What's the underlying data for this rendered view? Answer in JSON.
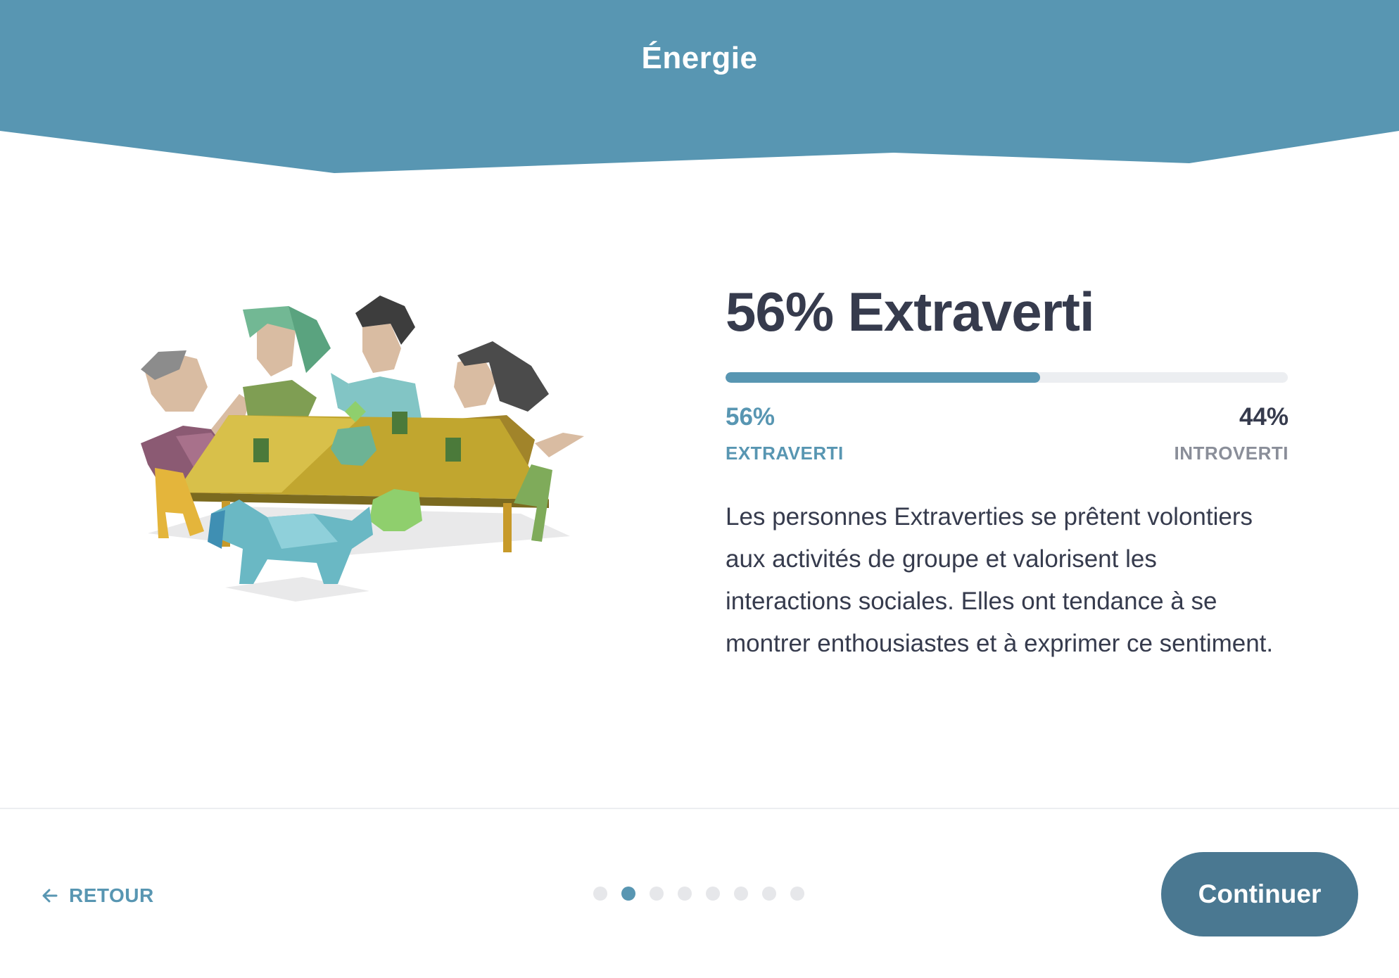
{
  "header": {
    "title": "Énergie"
  },
  "result": {
    "title": "56% Extraverti",
    "progress_fraction": 0.56,
    "left_percent": "56%",
    "left_label": "EXTRAVERTI",
    "right_percent": "44%",
    "right_label": "INTROVERTI",
    "description": "Les personnes Extraverties se prêtent volontiers aux activités de groupe et valorisent les interactions sociales. Elles ont tendance à se montrer enthousiastes et à exprimer ce sentiment."
  },
  "footer": {
    "back_label": "RETOUR",
    "continue_label": "Continuer",
    "page_count": 8,
    "active_page": 2
  },
  "colors": {
    "header": "#5896b2",
    "accent": "#5896b2",
    "continue_button": "#4a7891",
    "text": "#363b4d"
  },
  "icons": {
    "back": "arrow-left-icon",
    "illustration": "group-conversation-illustration"
  }
}
